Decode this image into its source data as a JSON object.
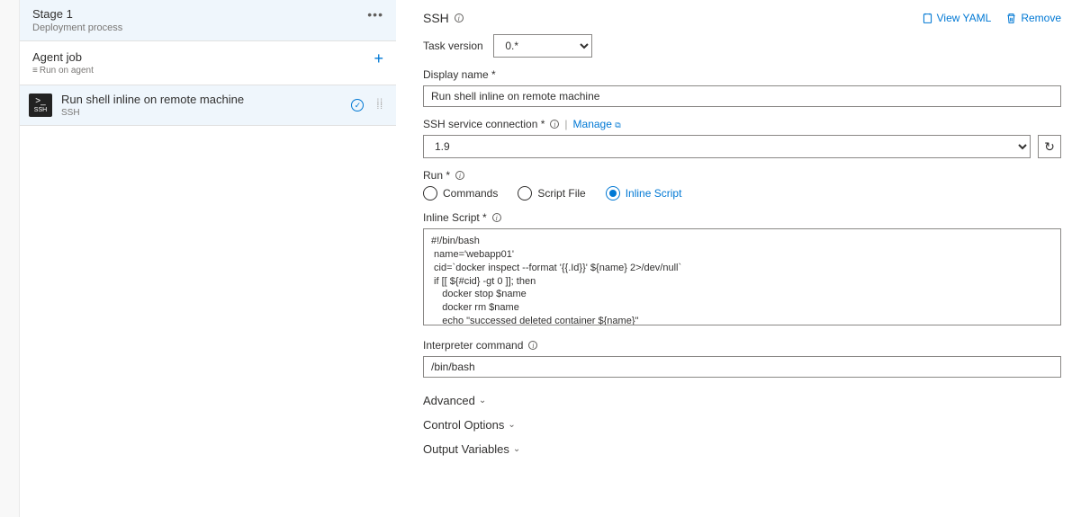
{
  "left": {
    "stage": {
      "title": "Stage 1",
      "subtitle": "Deployment process"
    },
    "job": {
      "title": "Agent job",
      "subtitle": "Run on agent"
    },
    "task": {
      "title": "Run shell inline on remote machine",
      "subtitle": "SSH",
      "iconLabel": "SSH"
    }
  },
  "right": {
    "headerTitle": "SSH",
    "viewYaml": "View YAML",
    "remove": "Remove",
    "taskVersion": {
      "label": "Task version",
      "value": "0.*"
    },
    "displayName": {
      "label": "Display name *",
      "value": "Run shell inline on remote machine"
    },
    "sshConn": {
      "label": "SSH service connection *",
      "manage": "Manage",
      "value": "1.9"
    },
    "run": {
      "label": "Run *",
      "opts": {
        "commands": "Commands",
        "scriptFile": "Script File",
        "inline": "Inline Script"
      },
      "selected": "inline"
    },
    "inlineScript": {
      "label": "Inline Script *",
      "value": "#!/bin/bash\n name='webapp01'\n cid=`docker inspect --format '{{.Id}}' ${name} 2>/dev/null`\n if [[ ${#cid} -gt 0 ]]; then\n    docker stop $name\n    docker rm $name\n    echo \"successed deleted container ${name}\"\n fi\n imageid=`docker images --format {{.ID}} $name`\n echo \"准备删除旧镜像${imageid}\""
    },
    "interpreter": {
      "label": "Interpreter command",
      "value": "/bin/bash"
    },
    "sections": {
      "advanced": "Advanced",
      "control": "Control Options",
      "output": "Output Variables"
    }
  }
}
